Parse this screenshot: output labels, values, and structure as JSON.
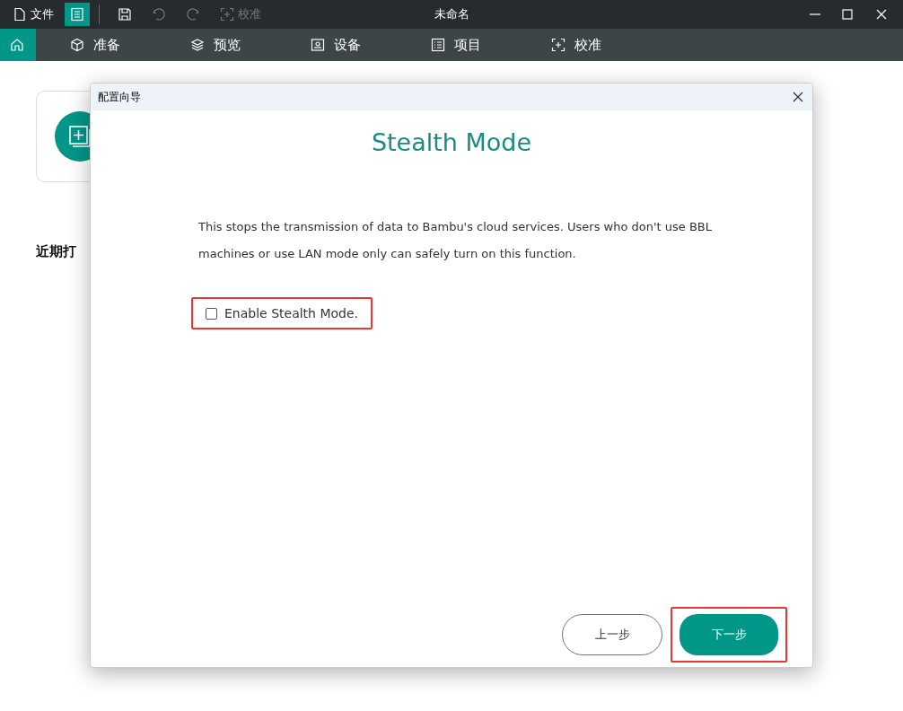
{
  "title_bar": {
    "file_menu": "文件",
    "calibrate": "校准",
    "title": "未命名"
  },
  "nav_tabs": [
    {
      "kind": "home",
      "selected": true
    },
    {
      "kind": "prepare",
      "label": "准备",
      "selected": false
    },
    {
      "kind": "preview",
      "label": "预览",
      "selected": false
    },
    {
      "kind": "device",
      "label": "设备",
      "selected": false
    },
    {
      "kind": "project",
      "label": "项目",
      "selected": false
    },
    {
      "kind": "calibrate",
      "label": "校准",
      "selected": false
    }
  ],
  "home": {
    "recent_heading": "近期打"
  },
  "dialog": {
    "title": "配置向导",
    "heading": "Stealth Mode",
    "description": "This stops the transmission of data to Bambu's cloud services. Users who don't use BBL machines or use LAN mode only can safely turn on this function.",
    "checkbox": {
      "label": "Enable Stealth Mode.",
      "checked": false
    },
    "back_button": "上一步",
    "next_button": "下一步"
  }
}
